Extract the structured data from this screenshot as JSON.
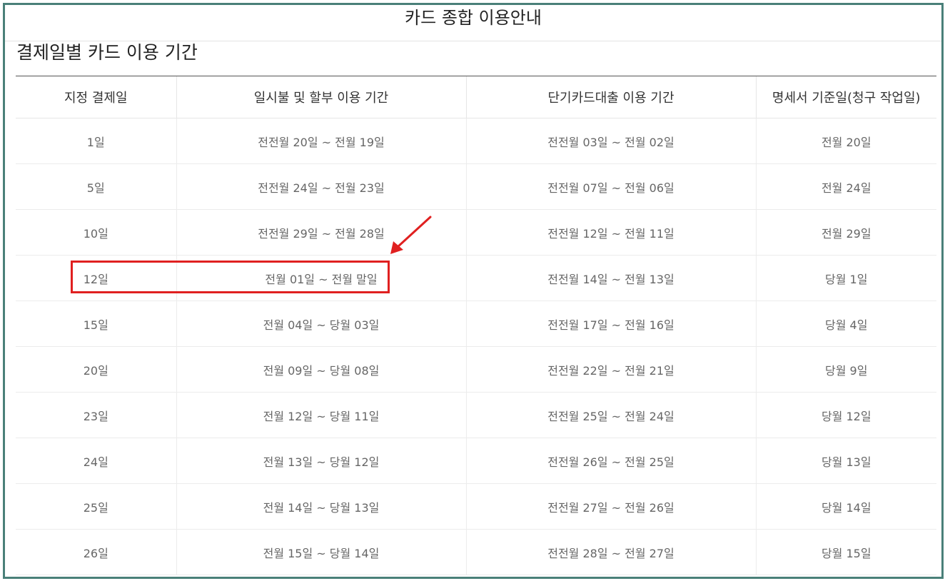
{
  "page_title": "카드 종합 이용안내",
  "section_title": "결제일별 카드 이용 기간",
  "table": {
    "headers": [
      "지정 결제일",
      "일시불 및 할부 이용 기간",
      "단기카드대출 이용 기간",
      "명세서 기준일(청구 작업일)"
    ],
    "rows": [
      [
        "1일",
        "전전월 20일 ~ 전월 19일",
        "전전월 03일 ~ 전월 02일",
        "전월 20일"
      ],
      [
        "5일",
        "전전월 24일 ~ 전월 23일",
        "전전월 07일 ~ 전월 06일",
        "전월 24일"
      ],
      [
        "10일",
        "전전월 29일 ~ 전월 28일",
        "전전월 12일 ~ 전월 11일",
        "전월 29일"
      ],
      [
        "12일",
        "전월 01일 ~ 전월 말일",
        "전전월 14일 ~ 전월 13일",
        "당월 1일"
      ],
      [
        "15일",
        "전월 04일 ~ 당월 03일",
        "전전월 17일 ~ 전월 16일",
        "당월 4일"
      ],
      [
        "20일",
        "전월 09일 ~ 당월 08일",
        "전전월 22일 ~ 전월 21일",
        "당월 9일"
      ],
      [
        "23일",
        "전월 12일 ~ 당월 11일",
        "전전월 25일 ~ 전월 24일",
        "당월 12일"
      ],
      [
        "24일",
        "전월 13일 ~ 당월 12일",
        "전전월 26일 ~ 전월 25일",
        "당월 13일"
      ],
      [
        "25일",
        "전월 14일 ~ 당월 13일",
        "전전월 27일 ~ 전월 26일",
        "당월 14일"
      ],
      [
        "26일",
        "전월 15일 ~ 당월 14일",
        "전전월 28일 ~ 전월 27일",
        "당월 15일"
      ]
    ]
  },
  "colors": {
    "frame_border": "#4a8079",
    "annotation": "#e02020"
  }
}
